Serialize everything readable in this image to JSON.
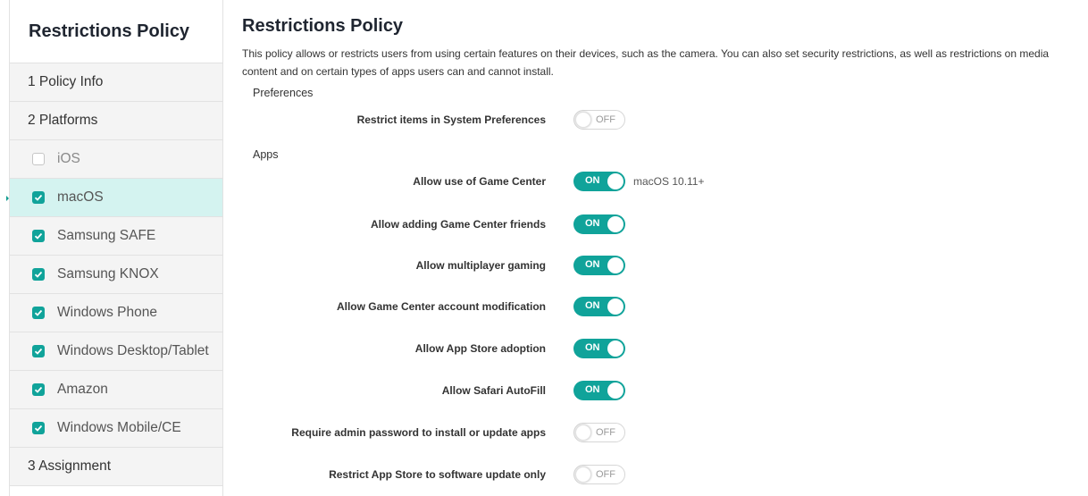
{
  "sidebar": {
    "title": "Restrictions Policy",
    "steps": [
      {
        "label": "1  Policy Info"
      },
      {
        "label": "2  Platforms"
      }
    ],
    "platforms": [
      {
        "label": "iOS",
        "checked": false
      },
      {
        "label": "macOS",
        "checked": true,
        "active": true
      },
      {
        "label": "Samsung SAFE",
        "checked": true
      },
      {
        "label": "Samsung KNOX",
        "checked": true
      },
      {
        "label": "Windows Phone",
        "checked": true
      },
      {
        "label": "Windows Desktop/Tablet",
        "checked": true
      },
      {
        "label": "Amazon",
        "checked": true
      },
      {
        "label": "Windows Mobile/CE",
        "checked": true
      }
    ],
    "assignment": {
      "label": "3  Assignment"
    }
  },
  "main": {
    "title": "Restrictions Policy",
    "description": "This policy allows or restricts users from using certain features on their devices, such as the camera. You can also set security restrictions, as well as restrictions on media content and on certain types of apps users can and cannot install.",
    "preferences": {
      "heading": "Preferences",
      "settings": [
        {
          "label": "Restrict items in System Preferences",
          "state": "OFF"
        }
      ]
    },
    "apps": {
      "heading": "Apps",
      "settings": [
        {
          "label": "Allow use of Game Center",
          "state": "ON",
          "note": "macOS 10.11+"
        },
        {
          "label": "Allow adding Game Center friends",
          "state": "ON"
        },
        {
          "label": "Allow multiplayer gaming",
          "state": "ON"
        },
        {
          "label": "Allow Game Center account modification",
          "state": "ON"
        },
        {
          "label": "Allow App Store adoption",
          "state": "ON"
        },
        {
          "label": "Allow Safari AutoFill",
          "state": "ON"
        },
        {
          "label": "Require admin password to install or update apps",
          "state": "OFF"
        },
        {
          "label": "Restrict App Store to software update only",
          "state": "OFF"
        }
      ]
    }
  },
  "colors": {
    "accent": "#10a39a",
    "active_bg": "#d4f3f0"
  }
}
